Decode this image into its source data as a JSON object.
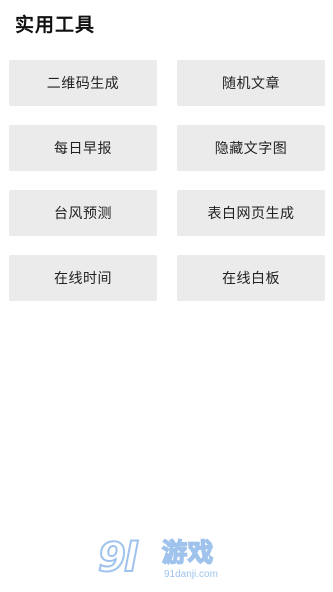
{
  "page": {
    "title": "实用工具"
  },
  "tools": [
    {
      "label": "二维码生成"
    },
    {
      "label": "随机文章"
    },
    {
      "label": "每日早报"
    },
    {
      "label": "隐藏文字图"
    },
    {
      "label": "台风预测"
    },
    {
      "label": "表白网页生成"
    },
    {
      "label": "在线时间"
    },
    {
      "label": "在线白板"
    }
  ],
  "watermark": {
    "logo_text": "9l",
    "game_text": "游戏",
    "domain": "91danji.com",
    "color": "#9fc3ec"
  },
  "colors": {
    "button_bg": "#ebebeb",
    "background": "#ffffff",
    "text": "#222222"
  }
}
